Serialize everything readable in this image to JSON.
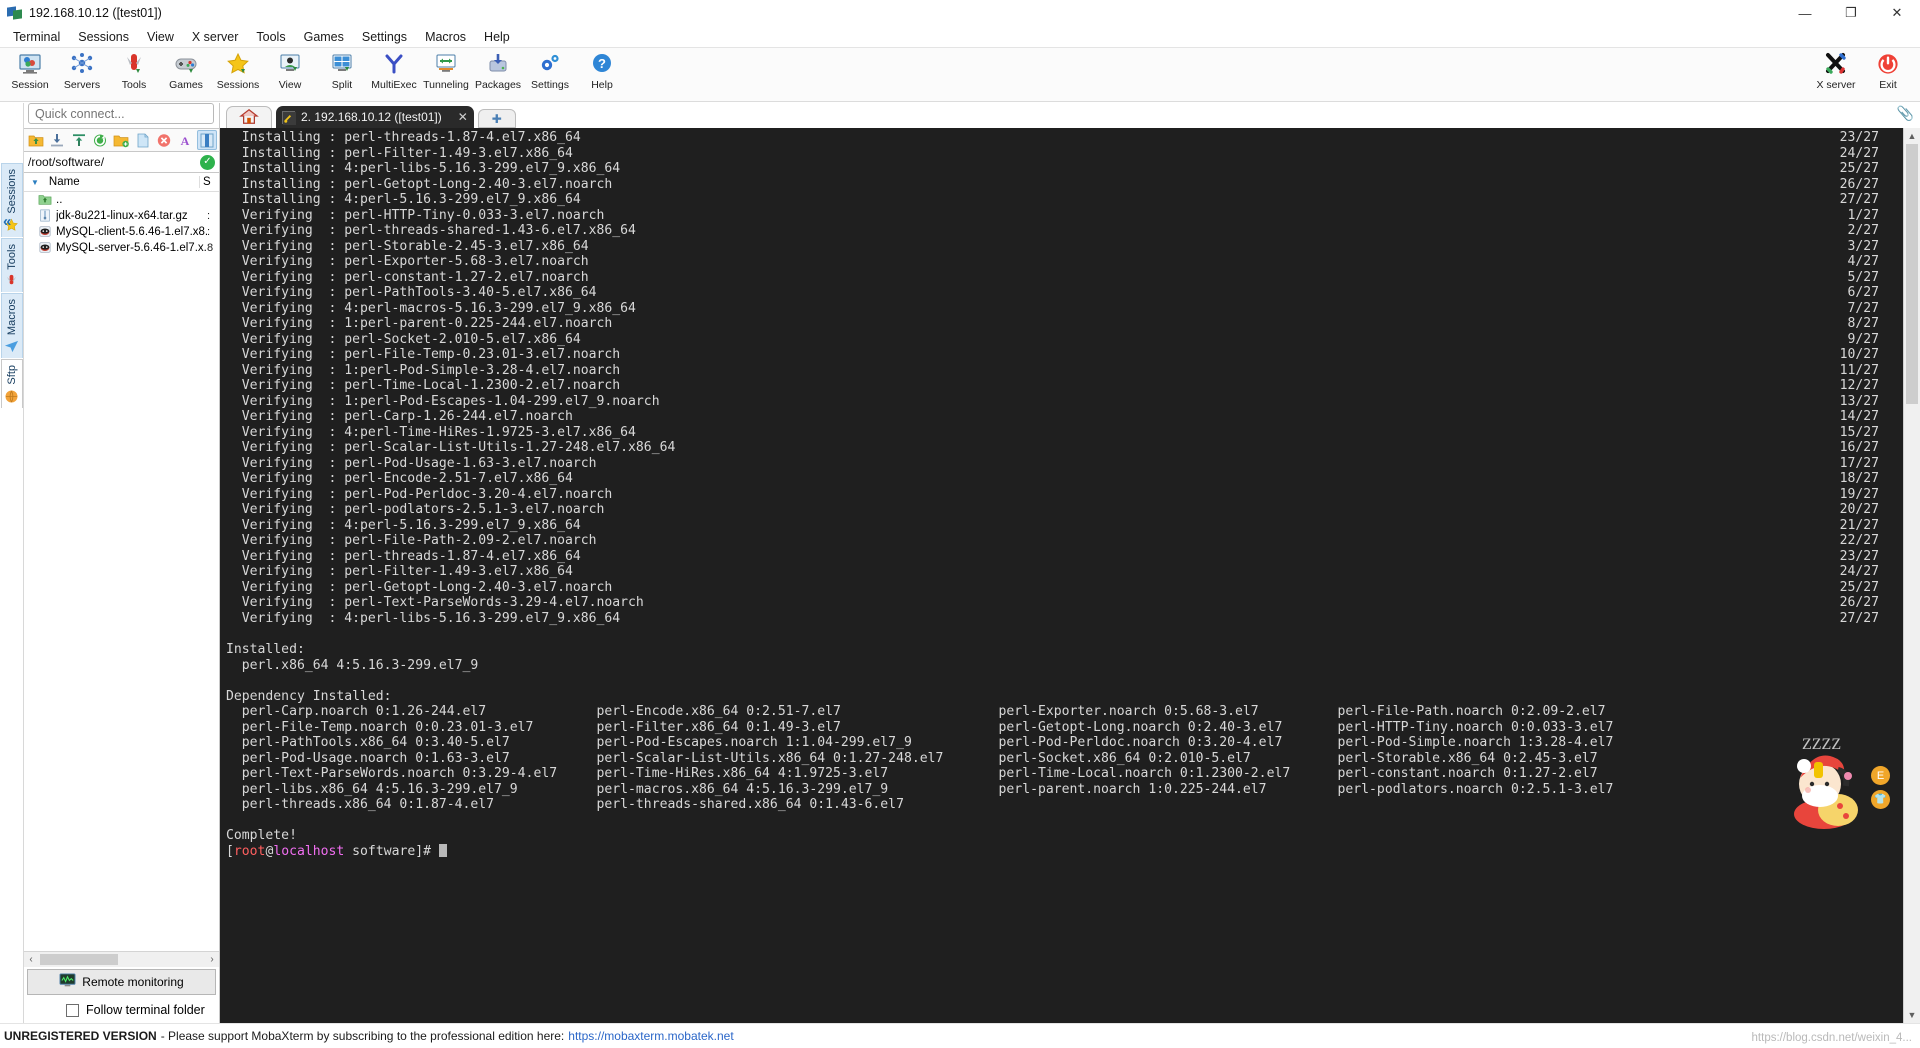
{
  "window": {
    "title": "192.168.10.12 ([test01])",
    "minimize": "—",
    "maximize": "❐",
    "close": "✕"
  },
  "menu": [
    "Terminal",
    "Sessions",
    "View",
    "X server",
    "Tools",
    "Games",
    "Settings",
    "Macros",
    "Help"
  ],
  "toolbar": {
    "items": [
      {
        "label": "Session",
        "icon": "session-icon"
      },
      {
        "label": "Servers",
        "icon": "servers-icon"
      },
      {
        "label": "Tools",
        "icon": "tools-icon"
      },
      {
        "label": "Games",
        "icon": "games-icon"
      },
      {
        "label": "Sessions",
        "icon": "sessions-star-icon"
      },
      {
        "label": "View",
        "icon": "view-icon"
      },
      {
        "label": "Split",
        "icon": "split-icon"
      },
      {
        "label": "MultiExec",
        "icon": "multiexec-icon"
      },
      {
        "label": "Tunneling",
        "icon": "tunneling-icon"
      },
      {
        "label": "Packages",
        "icon": "packages-icon"
      },
      {
        "label": "Settings",
        "icon": "settings-gear-icon"
      },
      {
        "label": "Help",
        "icon": "help-icon"
      }
    ],
    "right": [
      {
        "label": "X server",
        "icon": "x-server-icon"
      },
      {
        "label": "Exit",
        "icon": "power-exit-icon"
      }
    ]
  },
  "sidebar": {
    "collapse": "«",
    "tabs": [
      {
        "label": "Sessions",
        "icon": "star-icon",
        "active": false
      },
      {
        "label": "Tools",
        "icon": "swiss-knife-icon",
        "active": false
      },
      {
        "label": "Macros",
        "icon": "paper-plane-icon",
        "active": false
      },
      {
        "label": "Sftp",
        "icon": "globe-icon",
        "active": true
      }
    ]
  },
  "quick_connect": {
    "placeholder": "Quick connect...",
    "value": ""
  },
  "sftp": {
    "toolbar_buttons": [
      "up-folder-icon",
      "download-icon",
      "upload-icon",
      "refresh-icon",
      "new-folder-icon",
      "new-file-icon",
      "delete-icon",
      "text-edit-icon",
      "toggle-panel-icon"
    ],
    "path": "/root/software/",
    "path_ok": "✓",
    "columns": {
      "name": "Name",
      "size": "S"
    },
    "files": [
      {
        "name": "..",
        "size": "",
        "icon": "parent-folder-icon"
      },
      {
        "name": "jdk-8u221-linux-x64.tar.gz",
        "size": ":",
        "icon": "archive-icon"
      },
      {
        "name": "MySQL-client-5.6.46-1.el7.x8...",
        "size": ":",
        "icon": "rpm-icon"
      },
      {
        "name": "MySQL-server-5.6.46-1.el7.x...",
        "size": "8",
        "icon": "rpm-icon"
      }
    ],
    "remote_monitoring": "Remote monitoring",
    "follow_terminal_folder": "Follow terminal folder",
    "scroll_left": "‹",
    "scroll_right": "›"
  },
  "tabs": {
    "home_icon": "home-icon",
    "terminal_tab": "2. 192.168.10.12 ([test01])",
    "close_glyph": "✕",
    "add_glyph": "✚"
  },
  "terminal": {
    "lines": [
      {
        "text": "  Installing : perl-threads-1.87-4.el7.x86_64",
        "count": "23/27"
      },
      {
        "text": "  Installing : perl-Filter-1.49-3.el7.x86_64",
        "count": "24/27"
      },
      {
        "text": "  Installing : 4:perl-libs-5.16.3-299.el7_9.x86_64",
        "count": "25/27"
      },
      {
        "text": "  Installing : perl-Getopt-Long-2.40-3.el7.noarch",
        "count": "26/27"
      },
      {
        "text": "  Installing : 4:perl-5.16.3-299.el7_9.x86_64",
        "count": "27/27"
      },
      {
        "text": "  Verifying  : perl-HTTP-Tiny-0.033-3.el7.noarch",
        "count": "1/27"
      },
      {
        "text": "  Verifying  : perl-threads-shared-1.43-6.el7.x86_64",
        "count": "2/27"
      },
      {
        "text": "  Verifying  : perl-Storable-2.45-3.el7.x86_64",
        "count": "3/27"
      },
      {
        "text": "  Verifying  : perl-Exporter-5.68-3.el7.noarch",
        "count": "4/27"
      },
      {
        "text": "  Verifying  : perl-constant-1.27-2.el7.noarch",
        "count": "5/27"
      },
      {
        "text": "  Verifying  : perl-PathTools-3.40-5.el7.x86_64",
        "count": "6/27"
      },
      {
        "text": "  Verifying  : 4:perl-macros-5.16.3-299.el7_9.x86_64",
        "count": "7/27"
      },
      {
        "text": "  Verifying  : 1:perl-parent-0.225-244.el7.noarch",
        "count": "8/27"
      },
      {
        "text": "  Verifying  : perl-Socket-2.010-5.el7.x86_64",
        "count": "9/27"
      },
      {
        "text": "  Verifying  : perl-File-Temp-0.23.01-3.el7.noarch",
        "count": "10/27"
      },
      {
        "text": "  Verifying  : 1:perl-Pod-Simple-3.28-4.el7.noarch",
        "count": "11/27"
      },
      {
        "text": "  Verifying  : perl-Time-Local-1.2300-2.el7.noarch",
        "count": "12/27"
      },
      {
        "text": "  Verifying  : 1:perl-Pod-Escapes-1.04-299.el7_9.noarch",
        "count": "13/27"
      },
      {
        "text": "  Verifying  : perl-Carp-1.26-244.el7.noarch",
        "count": "14/27"
      },
      {
        "text": "  Verifying  : 4:perl-Time-HiRes-1.9725-3.el7.x86_64",
        "count": "15/27"
      },
      {
        "text": "  Verifying  : perl-Scalar-List-Utils-1.27-248.el7.x86_64",
        "count": "16/27"
      },
      {
        "text": "  Verifying  : perl-Pod-Usage-1.63-3.el7.noarch",
        "count": "17/27"
      },
      {
        "text": "  Verifying  : perl-Encode-2.51-7.el7.x86_64",
        "count": "18/27"
      },
      {
        "text": "  Verifying  : perl-Pod-Perldoc-3.20-4.el7.noarch",
        "count": "19/27"
      },
      {
        "text": "  Verifying  : perl-podlators-2.5.1-3.el7.noarch",
        "count": "20/27"
      },
      {
        "text": "  Verifying  : 4:perl-5.16.3-299.el7_9.x86_64",
        "count": "21/27"
      },
      {
        "text": "  Verifying  : perl-File-Path-2.09-2.el7.noarch",
        "count": "22/27"
      },
      {
        "text": "  Verifying  : perl-threads-1.87-4.el7.x86_64",
        "count": "23/27"
      },
      {
        "text": "  Verifying  : perl-Filter-1.49-3.el7.x86_64",
        "count": "24/27"
      },
      {
        "text": "  Verifying  : perl-Getopt-Long-2.40-3.el7.noarch",
        "count": "25/27"
      },
      {
        "text": "  Verifying  : perl-Text-ParseWords-3.29-4.el7.noarch",
        "count": "26/27"
      },
      {
        "text": "  Verifying  : 4:perl-libs-5.16.3-299.el7_9.x86_64",
        "count": "27/27"
      },
      {
        "text": "",
        "count": ""
      },
      {
        "text": "Installed:",
        "count": ""
      },
      {
        "text": "  perl.x86_64 4:5.16.3-299.el7_9",
        "count": ""
      },
      {
        "text": "",
        "count": ""
      },
      {
        "text": "Dependency Installed:",
        "count": ""
      },
      {
        "text": "  perl-Carp.noarch 0:1.26-244.el7              perl-Encode.x86_64 0:2.51-7.el7                    perl-Exporter.noarch 0:5.68-3.el7          perl-File-Path.noarch 0:2.09-2.el7",
        "count": ""
      },
      {
        "text": "  perl-File-Temp.noarch 0:0.23.01-3.el7        perl-Filter.x86_64 0:1.49-3.el7                    perl-Getopt-Long.noarch 0:2.40-3.el7       perl-HTTP-Tiny.noarch 0:0.033-3.el7",
        "count": ""
      },
      {
        "text": "  perl-PathTools.x86_64 0:3.40-5.el7           perl-Pod-Escapes.noarch 1:1.04-299.el7_9           perl-Pod-Perldoc.noarch 0:3.20-4.el7       perl-Pod-Simple.noarch 1:3.28-4.el7",
        "count": ""
      },
      {
        "text": "  perl-Pod-Usage.noarch 0:1.63-3.el7           perl-Scalar-List-Utils.x86_64 0:1.27-248.el7       perl-Socket.x86_64 0:2.010-5.el7           perl-Storable.x86_64 0:2.45-3.el7",
        "count": ""
      },
      {
        "text": "  perl-Text-ParseWords.noarch 0:3.29-4.el7     perl-Time-HiRes.x86_64 4:1.9725-3.el7              perl-Time-Local.noarch 0:1.2300-2.el7      perl-constant.noarch 0:1.27-2.el7",
        "count": ""
      },
      {
        "text": "  perl-libs.x86_64 4:5.16.3-299.el7_9          perl-macros.x86_64 4:5.16.3-299.el7_9              perl-parent.noarch 1:0.225-244.el7         perl-podlators.noarch 0:2.5.1-3.el7",
        "count": ""
      },
      {
        "text": "  perl-threads.x86_64 0:1.87-4.el7             perl-threads-shared.x86_64 0:1.43-6.el7",
        "count": ""
      },
      {
        "text": "",
        "count": ""
      },
      {
        "text": "Complete!",
        "count": ""
      }
    ],
    "prompt": {
      "bracket_open": "[",
      "user": "root",
      "at": "@",
      "host": "localhost",
      "dir": " software",
      "bracket_close": "]#",
      "cursor": " "
    },
    "scroll_up": "▲",
    "scroll_down": "▼"
  },
  "mascot": {
    "zzz": "ZZZZ",
    "badge_e": "E",
    "badge_shirt": "👕"
  },
  "status": {
    "unregistered": "UNREGISTERED VERSION",
    "message": "- Please support MobaXterm by subscribing to the professional edition here:",
    "link": "https://mobaxterm.mobatek.net",
    "watermark": "https://blog.csdn.net/weixin_4..."
  },
  "colors": {
    "terminal_bg": "#1f1f1f",
    "terminal_fg": "#d8d8d8",
    "prompt_user": "#ff5f5f",
    "prompt_host": "#f06ef0",
    "accent_blue": "#2a66c8",
    "ok_green": "#2eb24c"
  }
}
